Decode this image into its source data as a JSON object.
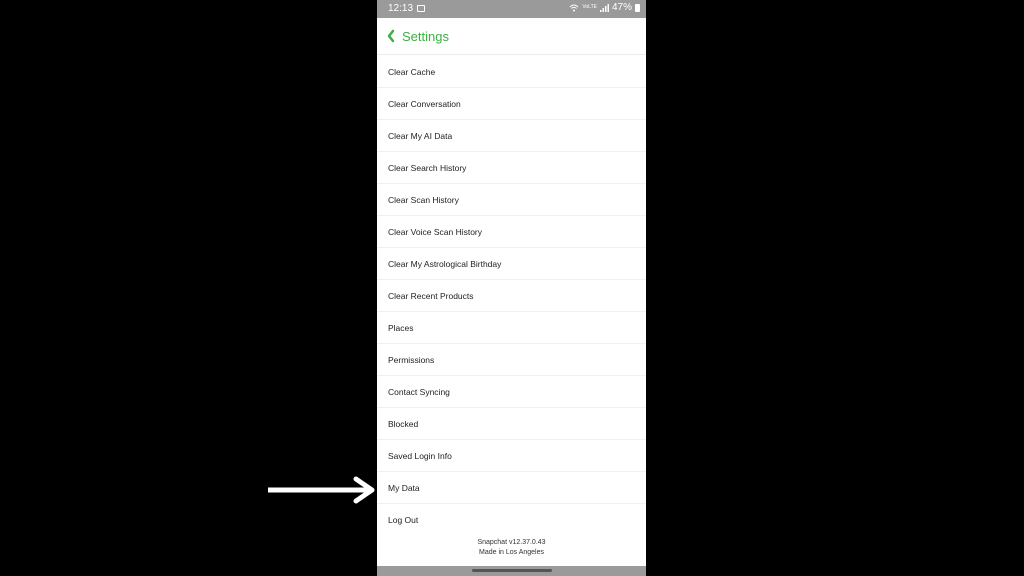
{
  "status_bar": {
    "time": "12:13",
    "signal_text": "VoLTE",
    "battery": "47%"
  },
  "header": {
    "title": "Settings",
    "back_icon": "chevron-left-icon"
  },
  "settings_items": [
    "Clear Cache",
    "Clear Conversation",
    "Clear My AI Data",
    "Clear Search History",
    "Clear Scan History",
    "Clear Voice Scan History",
    "Clear My Astrological Birthday",
    "Clear Recent Products",
    "Places",
    "Permissions",
    "Contact Syncing",
    "Blocked",
    "Saved Login Info",
    "My Data",
    "Log Out"
  ],
  "footer": {
    "version": "Snapchat v12.37.0.43",
    "made_in": "Made in Los Angeles"
  },
  "annotation": {
    "icon": "arrow-right-icon",
    "points_to": "My Data"
  },
  "colors": {
    "accent": "#3cb043",
    "status_bar": "#9a9a9a",
    "background": "#000000"
  }
}
